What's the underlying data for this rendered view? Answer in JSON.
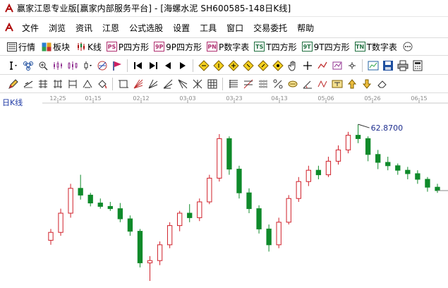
{
  "window": {
    "title": "赢家江恩专业版[赢家内部服务平台] - [海螺水泥  SH600585-148日K线]"
  },
  "menu": [
    "文件",
    "浏览",
    "资讯",
    "江恩",
    "公式选股",
    "设置",
    "工具",
    "窗口",
    "交易委托",
    "帮助"
  ],
  "toolbar1": [
    {
      "label": "行情",
      "icon": "quote-icon"
    },
    {
      "label": "板块",
      "icon": "sector-icon"
    },
    {
      "label": "K线",
      "icon": "kline-icon"
    },
    {
      "label": "P四方形",
      "icon": "ps-icon",
      "badge": "PS"
    },
    {
      "label": "9P四方形",
      "icon": "9p-icon",
      "badge": "9P"
    },
    {
      "label": "P数字表",
      "icon": "pn-icon",
      "badge": "PN"
    },
    {
      "label": "T四方形",
      "icon": "ts-icon",
      "badge": "TS"
    },
    {
      "label": "9T四方形",
      "icon": "9t-icon",
      "badge": "9T"
    },
    {
      "label": "T数字表",
      "icon": "tn-icon",
      "badge": "TN"
    }
  ],
  "chart": {
    "period_label": "日K线",
    "date_ticks": [
      "12-25",
      "01-15",
      "02-12",
      "03-03",
      "03-23",
      "04-13",
      "05-06",
      "05-26",
      "06-15"
    ],
    "max_label": "62.8700",
    "colors": {
      "up": "#d0202a",
      "down": "#0f8a2a",
      "axis": "#8c8c8c",
      "label": "#1f2f8f"
    }
  },
  "chart_data": {
    "type": "candlestick",
    "title": "海螺水泥 SH600585 日K线",
    "x_tick_labels": [
      "12-25",
      "01-15",
      "02-12",
      "03-03",
      "03-23",
      "04-13",
      "05-06",
      "05-26",
      "06-15"
    ],
    "annotations": [
      {
        "text": "62.8700",
        "meaning": "period high"
      }
    ],
    "ylabel": "",
    "series": [
      {
        "name": "海螺水泥",
        "ohlc_approx": [
          [
            52.6,
            53.6,
            52.2,
            53.3
          ],
          [
            53.3,
            55.4,
            53.0,
            55.0
          ],
          [
            55.0,
            57.6,
            54.6,
            57.2
          ],
          [
            57.2,
            58.4,
            56.2,
            56.6
          ],
          [
            56.6,
            56.8,
            55.6,
            55.9
          ],
          [
            55.9,
            56.3,
            55.4,
            55.6
          ],
          [
            55.6,
            56.0,
            55.2,
            55.4
          ],
          [
            55.4,
            55.9,
            54.2,
            54.5
          ],
          [
            54.5,
            54.8,
            53.0,
            53.4
          ],
          [
            53.4,
            53.6,
            50.2,
            50.6
          ],
          [
            50.6,
            51.2,
            49.0,
            50.8
          ],
          [
            50.8,
            52.5,
            50.4,
            52.2
          ],
          [
            52.2,
            54.2,
            51.9,
            53.9
          ],
          [
            53.9,
            55.2,
            53.4,
            55.0
          ],
          [
            55.0,
            55.8,
            54.2,
            54.6
          ],
          [
            54.6,
            56.3,
            54.3,
            56.0
          ],
          [
            56.0,
            58.4,
            55.8,
            58.1
          ],
          [
            58.1,
            62.0,
            57.8,
            61.6
          ],
          [
            61.6,
            61.8,
            58.4,
            58.9
          ],
          [
            58.9,
            59.2,
            56.3,
            56.8
          ],
          [
            56.8,
            57.2,
            55.0,
            55.4
          ],
          [
            55.4,
            55.7,
            53.2,
            53.6
          ],
          [
            53.6,
            54.0,
            51.6,
            52.2
          ],
          [
            52.2,
            54.6,
            51.9,
            54.2
          ],
          [
            54.2,
            56.6,
            54.0,
            56.3
          ],
          [
            56.3,
            58.2,
            56.0,
            57.8
          ],
          [
            57.8,
            59.2,
            57.4,
            58.8
          ],
          [
            58.8,
            59.2,
            58.0,
            58.4
          ],
          [
            58.4,
            60.0,
            58.2,
            59.6
          ],
          [
            59.6,
            61.0,
            59.3,
            60.6
          ],
          [
            60.6,
            62.2,
            60.3,
            61.9
          ],
          [
            61.9,
            62.87,
            61.2,
            61.6
          ],
          [
            61.6,
            61.8,
            59.6,
            60.2
          ],
          [
            60.2,
            60.6,
            58.9,
            59.5
          ],
          [
            59.5,
            60.0,
            58.8,
            59.2
          ],
          [
            59.2,
            59.4,
            58.4,
            58.8
          ],
          [
            58.8,
            59.1,
            58.0,
            58.5
          ],
          [
            58.5,
            58.8,
            57.6,
            58.0
          ],
          [
            58.0,
            58.2,
            56.9,
            57.3
          ],
          [
            57.3,
            57.6,
            56.8,
            57.0
          ]
        ]
      }
    ],
    "ylim": [
      48.5,
      63.5
    ]
  }
}
